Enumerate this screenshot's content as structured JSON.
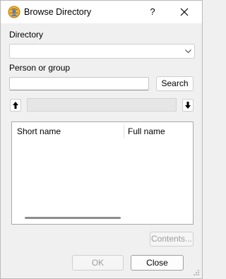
{
  "window": {
    "title": "Browse Directory",
    "help_glyph": "?"
  },
  "directory": {
    "label": "Directory",
    "value": ""
  },
  "person_group": {
    "label": "Person or group",
    "value": "",
    "search_label": "Search"
  },
  "list": {
    "columns": [
      "Short name",
      "Full name"
    ]
  },
  "buttons": {
    "contents": "Contents...",
    "ok": "OK",
    "close": "Close"
  },
  "icons": {
    "app": "globe-person-icon",
    "close": "close-icon",
    "dropdown": "chevron-down-icon",
    "up": "arrow-up-icon",
    "down": "arrow-down-icon"
  }
}
